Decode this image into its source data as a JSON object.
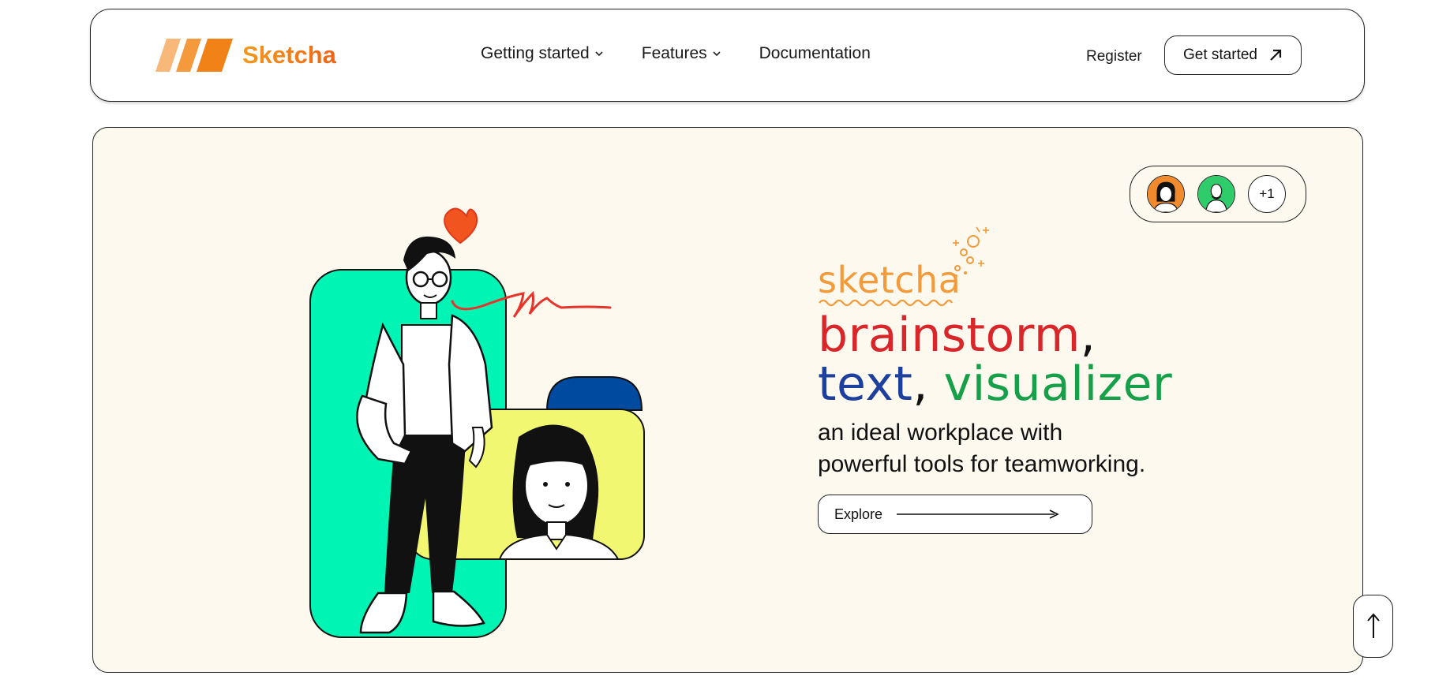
{
  "nav": {
    "logo_text": "Sketcha",
    "links": [
      {
        "label": "Getting started",
        "has_dropdown": true
      },
      {
        "label": "Features",
        "has_dropdown": true
      },
      {
        "label": "Documentation",
        "has_dropdown": false
      }
    ],
    "register_label": "Register",
    "cta_label": "Get started",
    "cta_icon": "arrow-up-right-icon"
  },
  "hero": {
    "brand_word": "sketcha",
    "headline": {
      "word1": "brainstorm",
      "sep1": ",",
      "word2": "text",
      "sep2": ",",
      "word3": "visualizer"
    },
    "subline_1": "an ideal workplace with",
    "subline_2": "powerful tools for teamworking.",
    "explore_label": "Explore",
    "avatars": {
      "items": [
        "avatar-woman-orange",
        "avatar-man-green"
      ],
      "more_label": "+1"
    },
    "scroll_top_icon": "arrow-up-icon"
  },
  "colors": {
    "brand_orange": "#f39a1c",
    "hero_bg": "#fdf9ee",
    "teal": "#00f5b4",
    "yellow": "#f2f772",
    "blue_tab": "#004aa0",
    "headline_red": "#d8262b",
    "headline_blue": "#1d3f9e",
    "headline_green": "#16a04a"
  }
}
